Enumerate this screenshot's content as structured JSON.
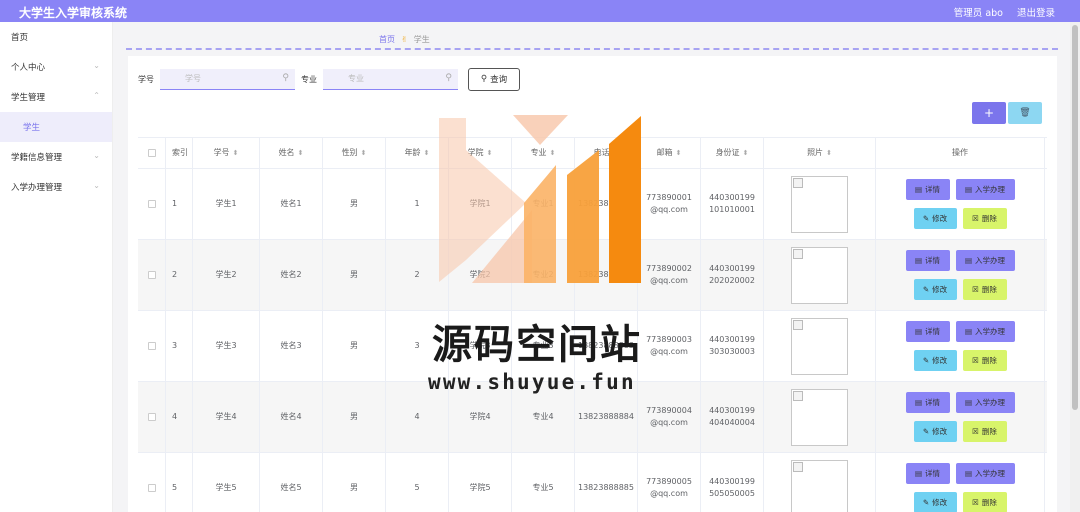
{
  "app": {
    "title": "大学生入学审核系统"
  },
  "topbar": {
    "admin_label": "管理员 abo",
    "logout_label": "退出登录"
  },
  "sidebar": {
    "items": [
      {
        "label": "首页",
        "has_chevron": false
      },
      {
        "label": "个人中心",
        "has_chevron": true
      },
      {
        "label": "学生管理",
        "has_chevron": true
      },
      {
        "label": "学生",
        "sub": true,
        "active": true
      },
      {
        "label": "学籍信息管理",
        "has_chevron": true
      },
      {
        "label": "入学办理管理",
        "has_chevron": true
      }
    ]
  },
  "breadcrumb": {
    "home": "首页",
    "current": "学生"
  },
  "search": {
    "xuehao_label": "学号",
    "xuehao_placeholder": "学号",
    "zhuanye_label": "专业",
    "zhuanye_placeholder": "专业",
    "query_label": "查询"
  },
  "toolbar": {
    "add_label": "+"
  },
  "table": {
    "columns": [
      "索引",
      "学号",
      "姓名",
      "性别",
      "年龄",
      "学院",
      "专业",
      "电话",
      "邮箱",
      "身份证",
      "照片",
      "操作"
    ],
    "rows": [
      {
        "index": "1",
        "xuehao": "学生1",
        "name": "姓名1",
        "gender": "男",
        "age": "1",
        "college": "学院1",
        "major": "专业1",
        "phone": "13823888881",
        "email": "773890001@qq.com",
        "idcard": "440300199101010001"
      },
      {
        "index": "2",
        "xuehao": "学生2",
        "name": "姓名2",
        "gender": "男",
        "age": "2",
        "college": "学院2",
        "major": "专业2",
        "phone": "13823888882",
        "email": "773890002@qq.com",
        "idcard": "440300199202020002"
      },
      {
        "index": "3",
        "xuehao": "学生3",
        "name": "姓名3",
        "gender": "男",
        "age": "3",
        "college": "学院3",
        "major": "专业3",
        "phone": "13823888883",
        "email": "773890003@qq.com",
        "idcard": "440300199303030003"
      },
      {
        "index": "4",
        "xuehao": "学生4",
        "name": "姓名4",
        "gender": "男",
        "age": "4",
        "college": "学院4",
        "major": "专业4",
        "phone": "13823888884",
        "email": "773890004@qq.com",
        "idcard": "440300199404040004"
      },
      {
        "index": "5",
        "xuehao": "学生5",
        "name": "姓名5",
        "gender": "男",
        "age": "5",
        "college": "学院5",
        "major": "专业5",
        "phone": "13823888885",
        "email": "773890005@qq.com",
        "idcard": "440300199505050005"
      }
    ],
    "actions": {
      "detail": "详情",
      "enroll": "入学办理",
      "edit": "修改",
      "delete": "删除"
    }
  },
  "watermark": {
    "name": "源码空间站",
    "url": "www.shuyue.fun"
  },
  "colors": {
    "accent": "#8a84f6",
    "edit": "#6fd1f2",
    "delete": "#d8f46a",
    "logo_peach": "#f7c6a9",
    "logo_orange": "#f58a0f"
  }
}
